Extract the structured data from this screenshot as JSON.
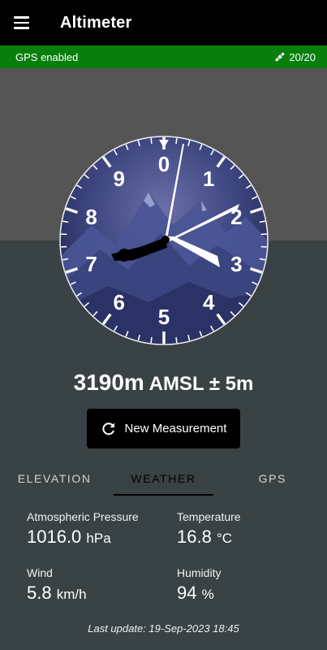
{
  "appbar": {
    "title": "Altimeter",
    "menu_icon": "hamburger-menu-icon"
  },
  "gps": {
    "status": "GPS enabled",
    "satellites": "20/20",
    "icon": "satellite-icon"
  },
  "dial": {
    "numerals": [
      "0",
      "1",
      "2",
      "3",
      "4",
      "5",
      "6",
      "7",
      "8",
      "9"
    ],
    "altitude_m": 3190,
    "bezel_color": "#14192e"
  },
  "reading": {
    "value": "3190m",
    "rest": " AMSL ± 5m"
  },
  "measure_button": {
    "label": "New Measurement",
    "icon": "refresh-icon"
  },
  "tabs": [
    {
      "label": "ELEVATION",
      "active": false
    },
    {
      "label": "WEATHER",
      "active": true
    },
    {
      "label": "GPS",
      "active": false
    }
  ],
  "weather": {
    "pressure": {
      "label": "Atmospheric Pressure",
      "value": "1016.0",
      "unit": "hPa"
    },
    "temperature": {
      "label": "Temperature",
      "value": "16.8",
      "unit": "°C"
    },
    "wind": {
      "label": "Wind",
      "value": "5.8",
      "unit": "km/h"
    },
    "humidity": {
      "label": "Humidity",
      "value": "94",
      "unit": "%"
    }
  },
  "last_update": "Last update: 19-Sep-2023 18:45",
  "colors": {
    "gps_bar": "#087f0d",
    "appbar": "#000000",
    "background": "#394244"
  }
}
